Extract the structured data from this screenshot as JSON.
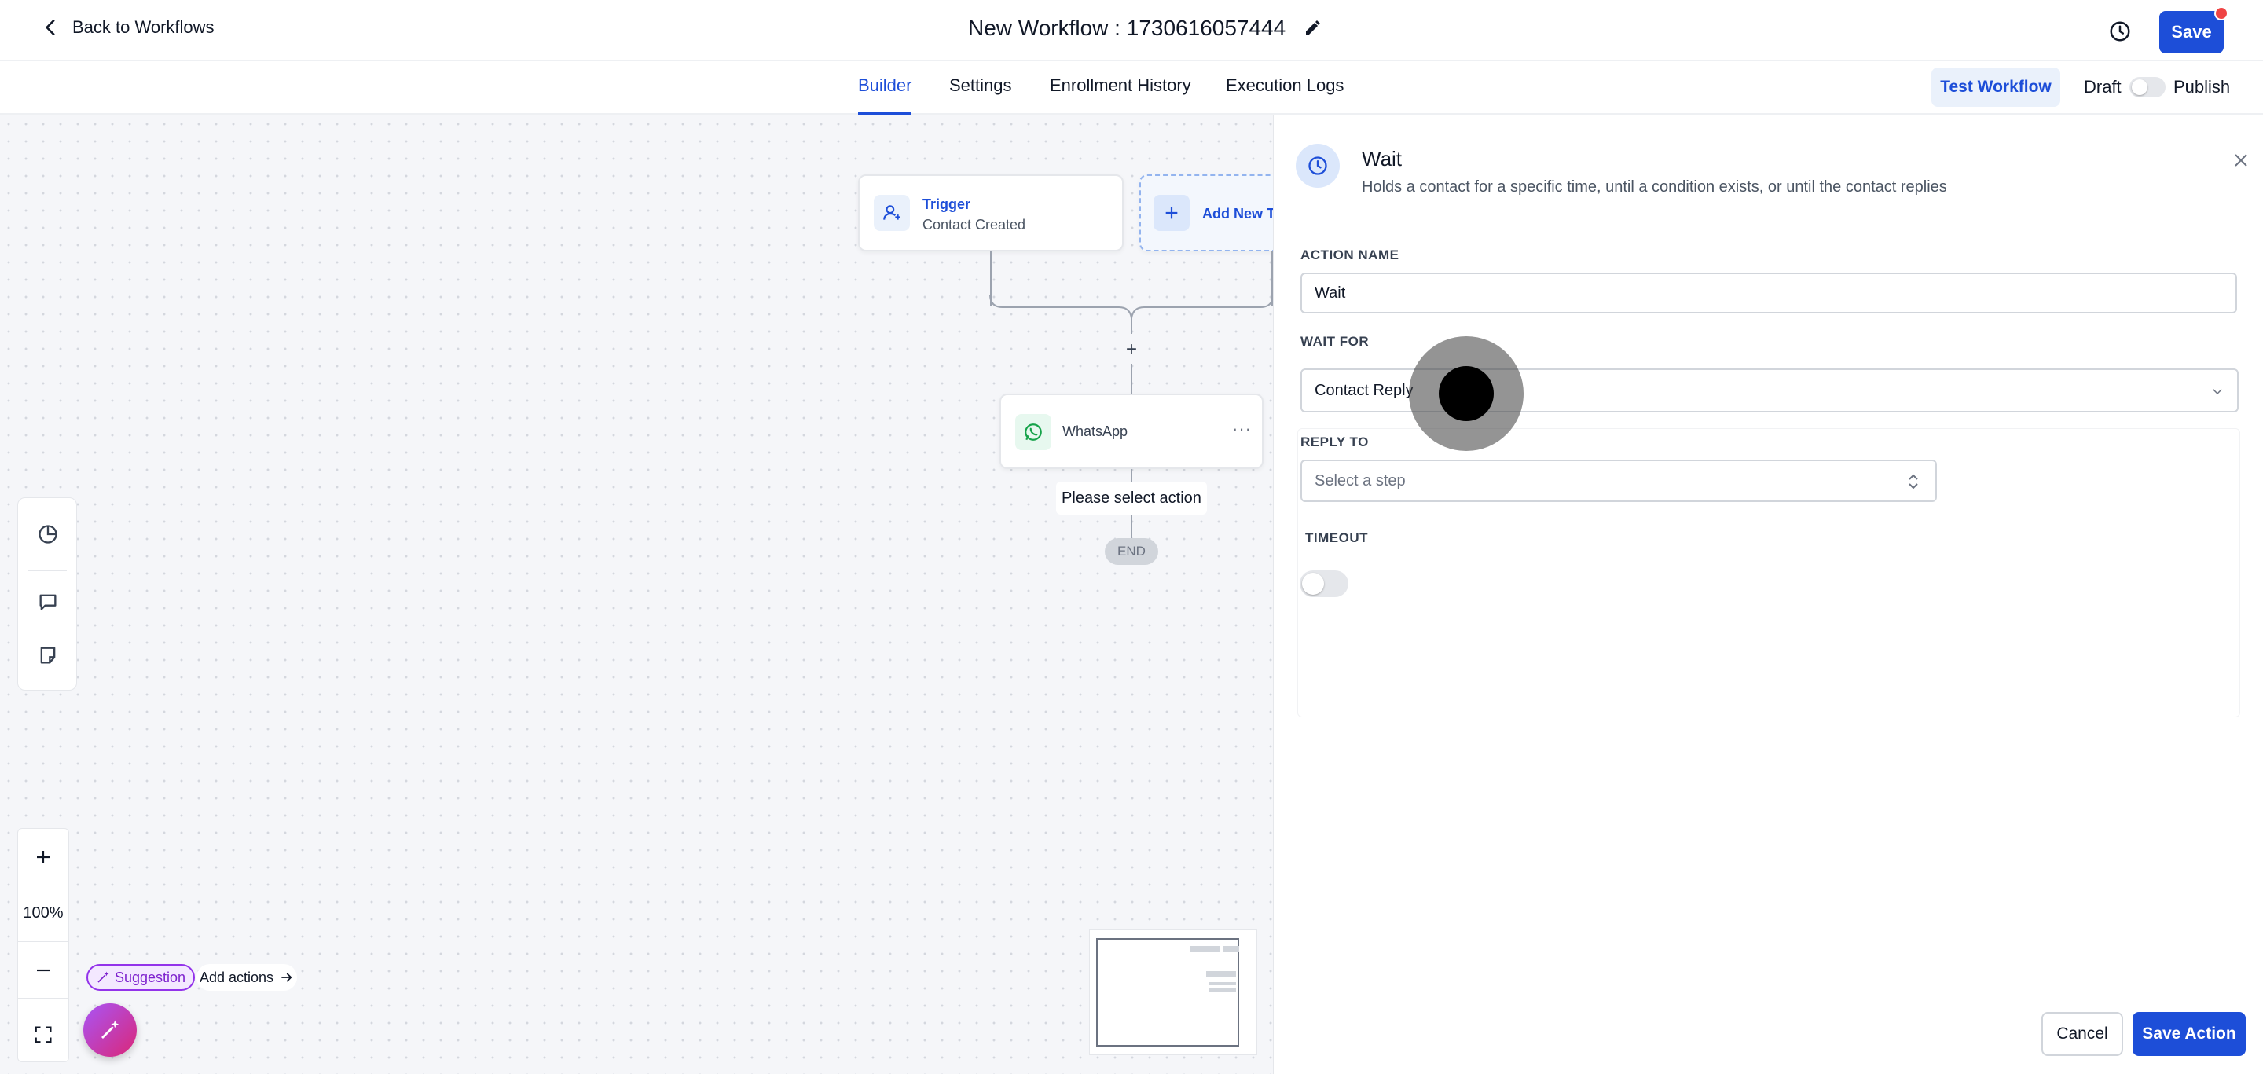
{
  "header": {
    "back_label": "Back to Workflows",
    "title": "New Workflow : 1730616057444",
    "save_label": "Save"
  },
  "tabs": [
    {
      "label": "Builder",
      "active": true
    },
    {
      "label": "Settings",
      "active": false
    },
    {
      "label": "Enrollment History",
      "active": false
    },
    {
      "label": "Execution Logs",
      "active": false
    }
  ],
  "actions": {
    "test_label": "Test Workflow",
    "draft_label": "Draft",
    "publish_label": "Publish",
    "publish_toggle_on": false
  },
  "canvas": {
    "trigger": {
      "title": "Trigger",
      "subtitle": "Contact Created"
    },
    "add_trigger_label": "Add New Tr",
    "action_node": {
      "label": "WhatsApp",
      "icon": "whatsapp-icon"
    },
    "select_action_label": "Please select action",
    "end_label": "END",
    "zoom_level": "100%",
    "suggestion_label": "Suggestion",
    "add_actions_label": "Add actions"
  },
  "panel": {
    "title": "Wait",
    "description": "Holds a contact for a specific time, until a condition exists, or until the contact replies",
    "action_name_label": "ACTION NAME",
    "action_name_value": "Wait",
    "wait_for_label": "WAIT FOR",
    "wait_for_value": "Contact Reply",
    "reply_to_label": "REPLY TO",
    "reply_to_placeholder": "Select a step",
    "timeout_label": "TIMEOUT",
    "timeout_on": false,
    "cancel_label": "Cancel",
    "save_action_label": "Save Action"
  },
  "colors": {
    "accent": "#1d4ed8",
    "notification": "#ef4444",
    "suggestion": "#9333ea"
  }
}
